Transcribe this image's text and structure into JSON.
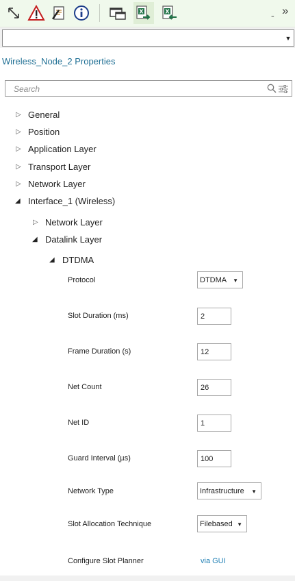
{
  "toolbar": {
    "buttons": [
      {
        "icon": "expand-arrows-icon"
      },
      {
        "icon": "warning-icon"
      },
      {
        "icon": "edit-notes-icon"
      },
      {
        "icon": "info-icon"
      },
      {
        "icon": "windows-icon"
      },
      {
        "icon": "excel-export-icon"
      },
      {
        "icon": "excel-import-icon"
      }
    ],
    "overflow_glyph": "₌",
    "more_glyph": "»"
  },
  "object_selector": {
    "value": ""
  },
  "panel": {
    "title": "Wireless_Node_2 Properties",
    "search_placeholder": "Search"
  },
  "tree": {
    "general": "General",
    "position": "Position",
    "application_layer": "Application Layer",
    "transport_layer": "Transport Layer",
    "network_layer": "Network Layer",
    "interface_1": "Interface_1 (Wireless)",
    "if_network_layer": "Network Layer",
    "datalink_layer": "Datalink Layer",
    "dtdma": "DTDMA"
  },
  "properties": {
    "protocol": {
      "label": "Protocol",
      "value": "DTDMA"
    },
    "slot_duration": {
      "label": "Slot Duration (ms)",
      "value": "2"
    },
    "frame_duration": {
      "label": "Frame Duration (s)",
      "value": "12"
    },
    "net_count": {
      "label": "Net Count",
      "value": "26"
    },
    "net_id": {
      "label": "Net ID",
      "value": "1"
    },
    "guard_interval": {
      "label": "Guard Interval (µs)",
      "value": "100"
    },
    "network_type": {
      "label": "Network Type",
      "value": "Infrastructure"
    },
    "slot_allocation": {
      "label": "Slot Allocation Technique",
      "value": "Filebased"
    },
    "slot_planner": {
      "label": "Configure Slot Planner",
      "link": "via GUI"
    }
  },
  "colors": {
    "toolbar_bg": "#f0f9ec",
    "title": "#1f6f94",
    "link": "#1f7fb4"
  }
}
